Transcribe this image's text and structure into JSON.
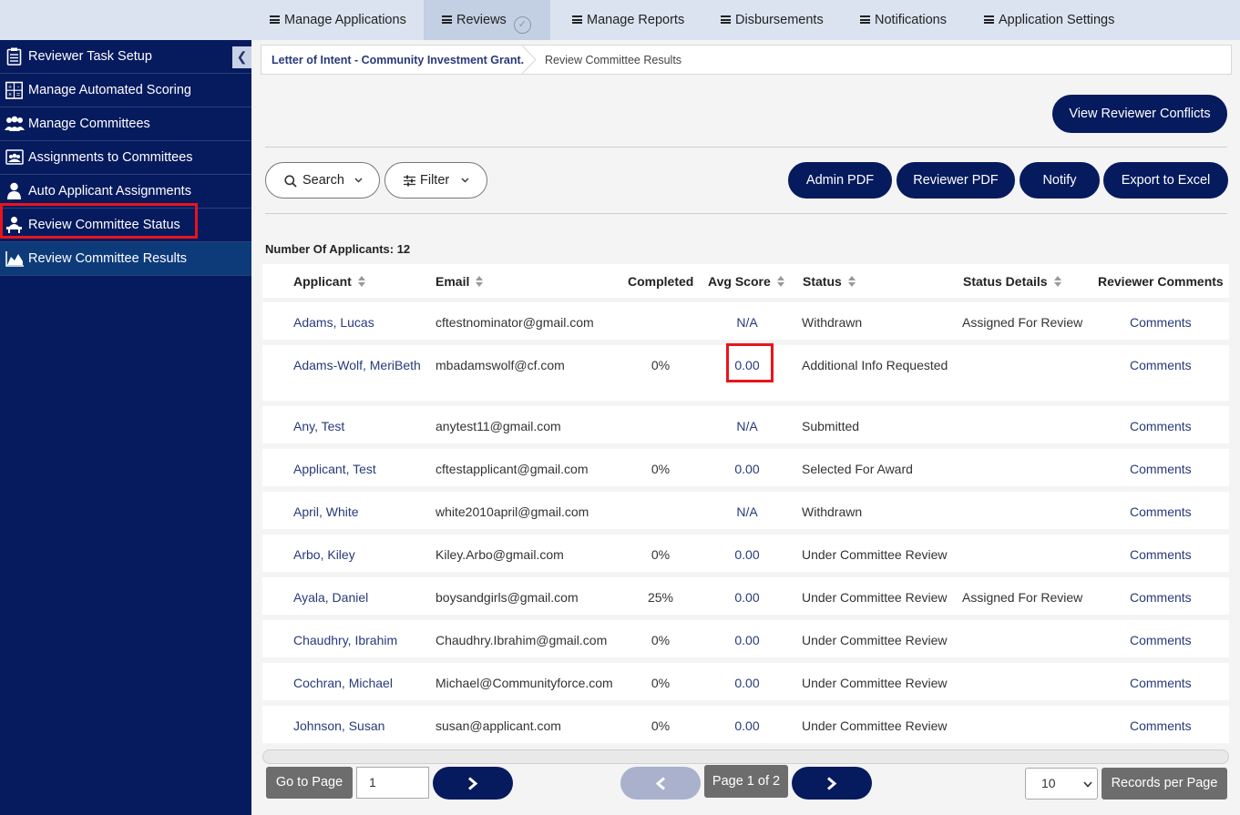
{
  "topnav": {
    "items": [
      {
        "label": "Manage Applications"
      },
      {
        "label": "Reviews"
      },
      {
        "label": "Manage Reports"
      },
      {
        "label": "Disbursements"
      },
      {
        "label": "Notifications"
      },
      {
        "label": "Application Settings"
      }
    ],
    "active": "Reviews"
  },
  "sidebar": {
    "items": [
      {
        "label": "Reviewer Task Setup",
        "icon": "clipboard-checklist-icon"
      },
      {
        "label": "Manage Automated Scoring",
        "icon": "calculator-icon"
      },
      {
        "label": "Manage Committees",
        "icon": "group-icon"
      },
      {
        "label": "Assignments to Committees",
        "icon": "committee-assign-icon"
      },
      {
        "label": "Auto Applicant Assignments",
        "icon": "user-icon"
      },
      {
        "label": "Review Committee Status",
        "icon": "reviewer-desk-icon"
      },
      {
        "label": "Review Committee Results",
        "icon": "area-chart-icon"
      }
    ],
    "active": "Review Committee Results"
  },
  "breadcrumb": {
    "parent": "Letter of Intent - Community Investment Grant.",
    "current": "Review Committee Results"
  },
  "actions": {
    "view_conflicts": "View Reviewer Conflicts",
    "search": "Search",
    "filter": "Filter",
    "admin_pdf": "Admin PDF",
    "reviewer_pdf": "Reviewer PDF",
    "notify": "Notify",
    "export_excel": "Export to Excel"
  },
  "applicant_count": "Number Of Applicants: 12",
  "table": {
    "headers": [
      "Applicant",
      "Email",
      "Completed",
      "Avg Score",
      "Status",
      "Status Details",
      "Reviewer Comments"
    ],
    "rows": [
      {
        "applicant": "Adams, Lucas",
        "email": "cftestnominator@gmail.com",
        "completed": "",
        "avg": "N/A",
        "status": "Withdrawn",
        "details": "Assigned For Review",
        "comments": "Comments"
      },
      {
        "applicant": "Adams-Wolf, MeriBeth",
        "email": "mbadamswolf@cf.com",
        "completed": "0%",
        "avg": "0.00",
        "status": "Additional Info Requested",
        "details": "",
        "comments": "Comments"
      },
      {
        "applicant": "Any, Test",
        "email": "anytest11@gmail.com",
        "completed": "",
        "avg": "N/A",
        "status": "Submitted",
        "details": "",
        "comments": "Comments"
      },
      {
        "applicant": "Applicant, Test",
        "email": "cftestapplicant@gmail.com",
        "completed": "0%",
        "avg": "0.00",
        "status": "Selected For Award",
        "details": "",
        "comments": "Comments"
      },
      {
        "applicant": "April, White",
        "email": "white2010april@gmail.com",
        "completed": "",
        "avg": "N/A",
        "status": "Withdrawn",
        "details": "",
        "comments": "Comments"
      },
      {
        "applicant": "Arbo, Kiley",
        "email": "Kiley.Arbo@gmail.com",
        "completed": "0%",
        "avg": "0.00",
        "status": "Under Committee Review",
        "details": "",
        "comments": "Comments"
      },
      {
        "applicant": "Ayala, Daniel",
        "email": "boysandgirls@gmail.com",
        "completed": "25%",
        "avg": "0.00",
        "status": "Under Committee Review",
        "details": "Assigned For Review",
        "comments": "Comments"
      },
      {
        "applicant": "Chaudhry, Ibrahim",
        "email": "Chaudhry.Ibrahim@gmail.com",
        "completed": "0%",
        "avg": "0.00",
        "status": "Under Committee Review",
        "details": "",
        "comments": "Comments"
      },
      {
        "applicant": "Cochran, Michael",
        "email": "Michael@Communityforce.com",
        "completed": "0%",
        "avg": "0.00",
        "status": "Under Committee Review",
        "details": "",
        "comments": "Comments"
      },
      {
        "applicant": "Johnson, Susan",
        "email": "susan@applicant.com",
        "completed": "0%",
        "avg": "0.00",
        "status": "Under Committee Review",
        "details": "",
        "comments": "Comments"
      }
    ]
  },
  "pagination": {
    "go_to_page": "Go to Page",
    "page_value": "1",
    "page_info": "Page 1 of 2",
    "per_page_value": "10",
    "records_per_page": "Records per Page"
  },
  "colors": {
    "navy": "#061a5e",
    "link": "#283a7a",
    "highlight": "#e8141c",
    "topnav_bg": "#dbe3f0"
  }
}
